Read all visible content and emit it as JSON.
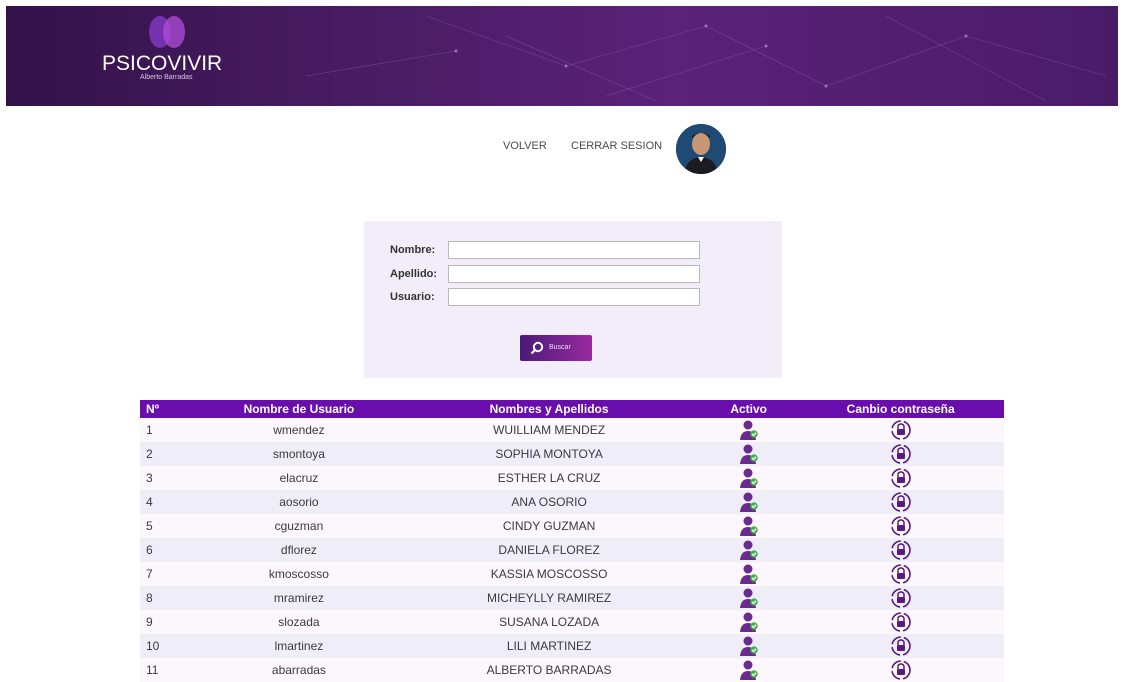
{
  "header": {
    "logo_title": "PSICOVIVIR",
    "logo_subtitle": "Alberto Barradas"
  },
  "nav": {
    "back_label": "VOLVER",
    "logout_label": "CERRAR SESION"
  },
  "search": {
    "nombre_label": "Nombre:",
    "nombre_value": "",
    "apellido_label": "Apellido:",
    "apellido_value": "",
    "usuario_label": "Usuario:",
    "usuario_value": "",
    "button_label": "Buscar"
  },
  "table": {
    "headers": [
      "Nº",
      "Nombre de Usuario",
      "Nombres y Apellidos",
      "Activo",
      "Canbio contraseña"
    ],
    "rows": [
      {
        "num": "1",
        "user": "wmendez",
        "name": "WUILLIAM MENDEZ"
      },
      {
        "num": "2",
        "user": "smontoya",
        "name": "SOPHIA MONTOYA"
      },
      {
        "num": "3",
        "user": "elacruz",
        "name": "ESTHER LA CRUZ"
      },
      {
        "num": "4",
        "user": "aosorio",
        "name": "ANA OSORIO"
      },
      {
        "num": "5",
        "user": "cguzman",
        "name": "CINDY GUZMAN"
      },
      {
        "num": "6",
        "user": "dflorez",
        "name": "DANIELA FLOREZ"
      },
      {
        "num": "7",
        "user": "kmoscosso",
        "name": "KASSIA MOSCOSSO"
      },
      {
        "num": "8",
        "user": "mramirez",
        "name": "MICHEYLLY RAMIREZ"
      },
      {
        "num": "9",
        "user": "slozada",
        "name": "SUSANA LOZADA"
      },
      {
        "num": "10",
        "user": "lmartinez",
        "name": "LILI MARTINEZ"
      },
      {
        "num": "11",
        "user": "abarradas",
        "name": "ALBERTO BARRADAS"
      }
    ]
  },
  "colors": {
    "banner": "#4b1d66",
    "table_header": "#6a0dad",
    "panel_bg": "#f3edf9",
    "active_icon": "#6a2a8a",
    "lock_icon": "#5a1a7a"
  },
  "icons": {
    "active": "user-check-icon",
    "password": "lock-refresh-icon",
    "search": "magnifier-icon"
  }
}
